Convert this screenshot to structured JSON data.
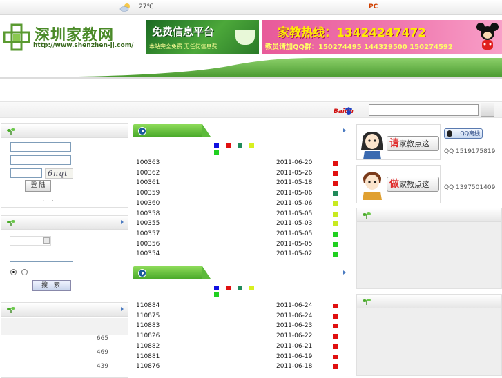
{
  "topbar": {
    "temperature": "27℃",
    "pc_label": "PC"
  },
  "header": {
    "logo_title": "深圳家教网",
    "logo_url": "http://www.shenzhen-jj.com/",
    "ad_free": {
      "title": "免费信息平台",
      "subtitle": "本站完全免费 无任何信息费"
    },
    "ad_hotline": {
      "title": "家教热线：13424247472",
      "subtitle": "教员请加QQ群：150274495 144329500 150274592"
    }
  },
  "searchbar": {
    "colon": ":",
    "engine_label": "Baidu"
  },
  "login": {
    "captcha": "6nqt",
    "login_label": "登 陆",
    "dots": "·     ·"
  },
  "search_panel": {
    "search_label": "搜 索"
  },
  "stats": {
    "values": [
      "665",
      "469",
      "439"
    ]
  },
  "legend_colors": [
    "#1010e0",
    "#e01010",
    "#208a5a",
    "#d8f020",
    "#20d020"
  ],
  "list1": {
    "rows": [
      {
        "id": "100363",
        "date": "2011-06-20",
        "color": "#e01010"
      },
      {
        "id": "100362",
        "date": "2011-05-26",
        "color": "#e01010"
      },
      {
        "id": "100361",
        "date": "2011-05-18",
        "color": "#e01010"
      },
      {
        "id": "100359",
        "date": "2011-05-06",
        "color": "#208a5a"
      },
      {
        "id": "100360",
        "date": "2011-05-06",
        "color": "#c8ea20"
      },
      {
        "id": "100358",
        "date": "2011-05-05",
        "color": "#c8ea20"
      },
      {
        "id": "100355",
        "date": "2011-05-03",
        "color": "#c8ea20"
      },
      {
        "id": "100357",
        "date": "2011-05-05",
        "color": "#20d020"
      },
      {
        "id": "100356",
        "date": "2011-05-05",
        "color": "#20d020"
      },
      {
        "id": "100354",
        "date": "2011-05-02",
        "color": "#20d020"
      }
    ]
  },
  "list2": {
    "rows": [
      {
        "id": "110884",
        "date": "2011-06-24",
        "color": "#e01010"
      },
      {
        "id": "110875",
        "date": "2011-06-24",
        "color": "#e01010"
      },
      {
        "id": "110883",
        "date": "2011-06-23",
        "color": "#e01010"
      },
      {
        "id": "110826",
        "date": "2011-06-22",
        "color": "#e01010"
      },
      {
        "id": "110882",
        "date": "2011-06-21",
        "color": "#e01010"
      },
      {
        "id": "110881",
        "date": "2011-06-19",
        "color": "#e01010"
      },
      {
        "id": "110876",
        "date": "2011-06-18",
        "color": "#e01010"
      }
    ]
  },
  "contact": {
    "request": {
      "prefix": "请",
      "label": "家教点这"
    },
    "become": {
      "prefix": "做",
      "label": "家教点这"
    },
    "qq_button": "QQ离线",
    "qq1": "QQ 1519175819",
    "qq2": "QQ 1397501409"
  }
}
